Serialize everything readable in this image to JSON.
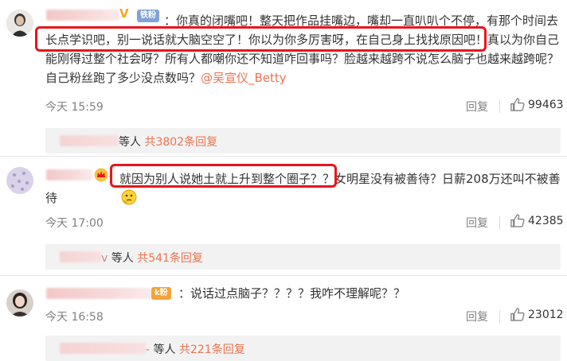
{
  "comments": [
    {
      "fan_badge": "铁粉",
      "text": "：你真的闭嘴吧！整天把作品挂嘴边，嘴却一直叭叭个不停，有那个时间去长点学识吧，别一说话就大脑空空了！你以为你多厉害呀，在自己身上找找原因吧！真以为你自己能刚得过整个社会呀？所有人都嘲你还不知道咋回事吗？脸越来越跨不说怎么脑子也越来越跨呢？自己粉丝跑了多少没点数吗？",
      "mention": "@吴宣仪_Betty",
      "time": "今天 15:59",
      "reply_label": "回复",
      "like_count": "99463",
      "replies_prefix": "等人",
      "replies_link": "共3802条回复"
    },
    {
      "text": "：就因为别人说她土就上升到整个圈子？？女明星没有被善待？日薪208万还叫不被善待",
      "emoji": "thinking-face",
      "time": "今天 17:00",
      "reply_label": "回复",
      "like_count": "42385",
      "replies_name_suffix": "v",
      "replies_prefix": "等人",
      "replies_link": "共541条回复"
    },
    {
      "fan_badge": "k粉",
      "text": "：说话过点脑子？？？？我咋不理解呢？？",
      "time": "今天 16:58",
      "reply_label": "回复",
      "like_count": "23012",
      "replies_name_suffix": "-",
      "replies_prefix": "等人",
      "replies_link": "共221条回复"
    }
  ],
  "icons": {
    "like": "thumbs-up-icon",
    "verified": "v-badge-icon",
    "crown": "crown-icon"
  },
  "colors": {
    "accent": "#eb7350",
    "highlight": "#e8151b",
    "meta": "#808080"
  }
}
